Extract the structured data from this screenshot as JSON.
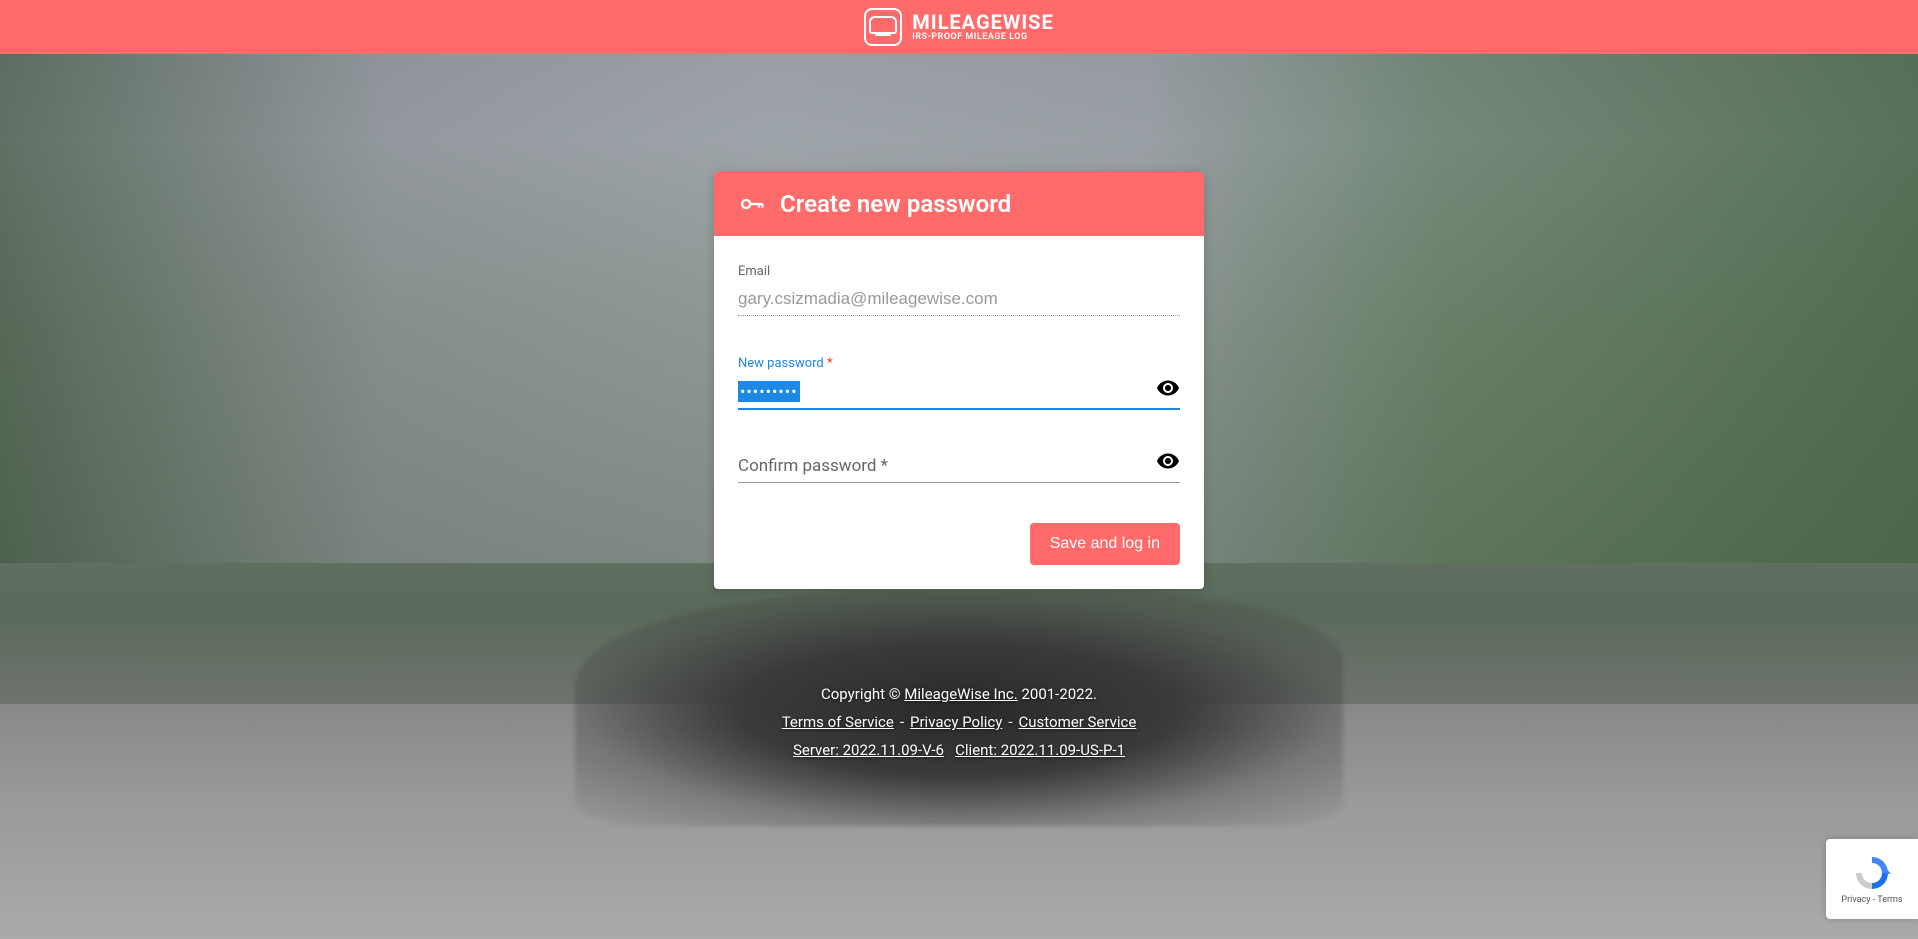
{
  "brand": {
    "name": "MILEAGEWISE",
    "tagline": "IRS-PROOF MILEAGE LOG"
  },
  "card": {
    "title": "Create new password",
    "email": {
      "label": "Email",
      "value": "gary.csizmadia@mileagewise.com"
    },
    "newPassword": {
      "label": "New password ",
      "required": "*",
      "value": "•••••••••"
    },
    "confirmPassword": {
      "label": "Confirm password *"
    },
    "submit": "Save and log in"
  },
  "footer": {
    "copyright_prefix": "Copyright © ",
    "company": "MileageWise Inc.",
    "years": " 2001-2022.",
    "links": {
      "terms": "Terms of Service",
      "privacy": "Privacy Policy",
      "customer": "Customer Service"
    },
    "server": "Server: 2022.11.09-V-6",
    "client": "Client: 2022.11.09-US-P-1"
  },
  "recaptcha": {
    "privacy": "Privacy",
    "terms": "Terms"
  }
}
